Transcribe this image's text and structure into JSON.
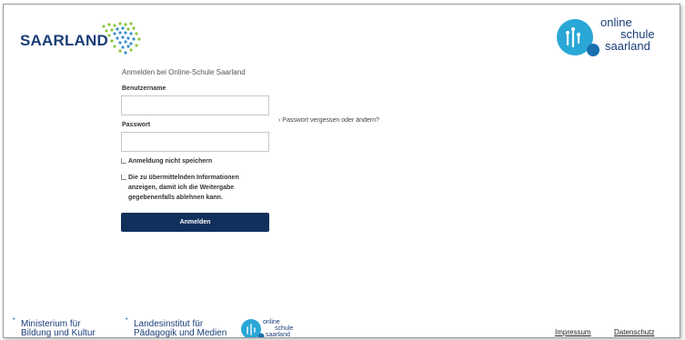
{
  "header": {
    "brand": "SAARLAND",
    "osl_logo": [
      "online",
      "schule",
      "saarland"
    ]
  },
  "form": {
    "title": "Anmelden bei Online-Schule Saarland",
    "username_label": "Benutzername",
    "username_value": "",
    "password_label": "Passwort",
    "password_value": "",
    "forgot_link": "› Passwort vergessen oder ändern?",
    "remember_label": "Anmeldung nicht speichern",
    "consent_label": "Die zu übermittelnden Informationen anzeigen, damit ich die Weitergabe gegebenenfalls ablehnen kann.",
    "submit_label": "Anmelden"
  },
  "footer": {
    "ministry": [
      "Ministerium für",
      "Bildung und Kultur"
    ],
    "institute": [
      "Landesinstitut für",
      "Pädagogik und Medien"
    ],
    "osl_small": [
      "online",
      "schule",
      "saarland"
    ],
    "impressum": "Impressum",
    "datenschutz": "Datenschutz"
  },
  "colors": {
    "brand_blue": "#1a3d78",
    "button_navy": "#12305c",
    "logo_teal": "#2aa7d6",
    "dot_green": "#8cc63f"
  }
}
